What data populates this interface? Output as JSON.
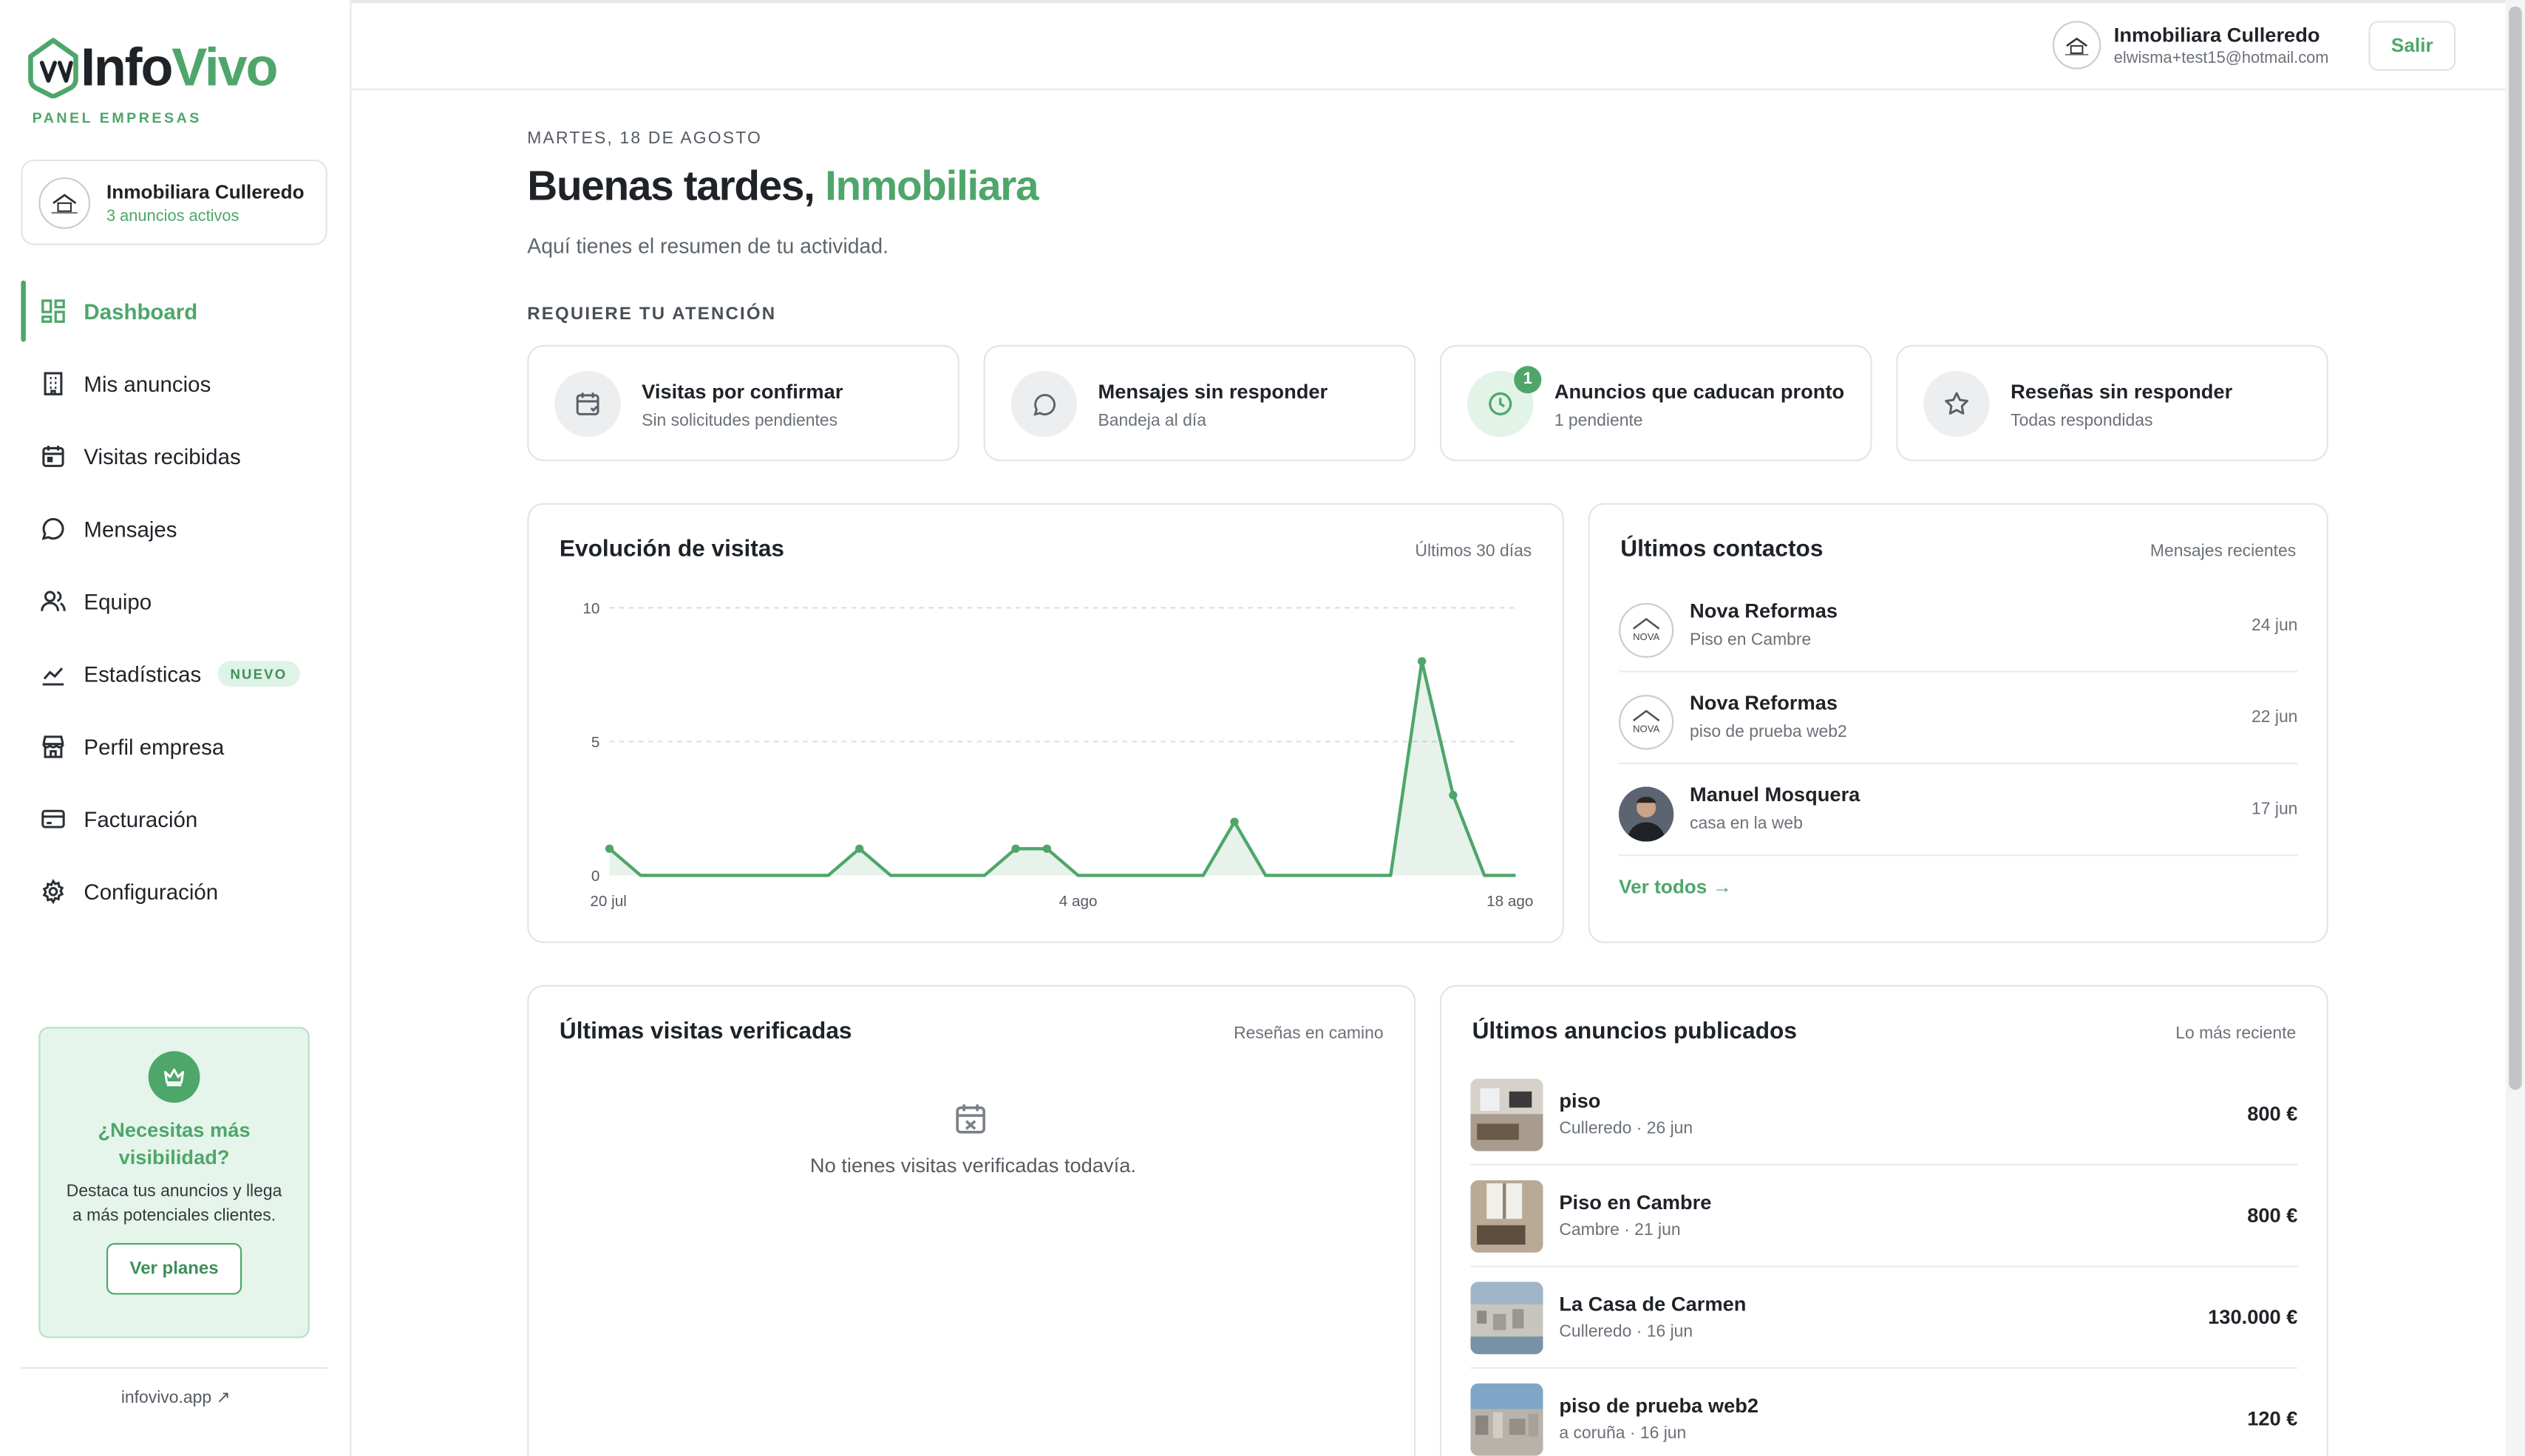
{
  "brand": {
    "name_a": "Info",
    "name_b": "Vivo",
    "subtitle": "PANEL EMPRESAS"
  },
  "sidebar": {
    "company": {
      "name": "Inmobiliara Culleredo",
      "status": "3 anuncios activos"
    },
    "items": [
      {
        "label": "Dashboard",
        "icon": "dashboard-icon",
        "active": true
      },
      {
        "label": "Mis anuncios",
        "icon": "building-icon"
      },
      {
        "label": "Visitas recibidas",
        "icon": "calendar-icon"
      },
      {
        "label": "Mensajes",
        "icon": "chat-icon"
      },
      {
        "label": "Equipo",
        "icon": "users-icon"
      },
      {
        "label": "Estadísticas",
        "icon": "chart-icon",
        "badge": "NUEVO"
      },
      {
        "label": "Perfil empresa",
        "icon": "store-icon"
      },
      {
        "label": "Facturación",
        "icon": "card-icon"
      },
      {
        "label": "Configuración",
        "icon": "gear-icon"
      }
    ],
    "promo": {
      "title": "¿Necesitas más visibilidad?",
      "text": "Destaca tus anuncios y llega a más potenciales clientes.",
      "button": "Ver planes"
    },
    "footer_link": "infovivo.app ↗"
  },
  "header": {
    "user_name": "Inmobiliara Culleredo",
    "user_email": "elwisma+test15@hotmail.com",
    "logout": "Salir"
  },
  "main": {
    "date": "MARTES, 18 DE AGOSTO",
    "greeting": "Buenas tardes, ",
    "greeting_name": "Inmobiliara",
    "subtitle": "Aquí tienes el resumen de tu actividad.",
    "attention_title": "REQUIERE TU ATENCIÓN",
    "attention": [
      {
        "title": "Visitas por confirmar",
        "sub": "Sin solicitudes pendientes",
        "icon": "calendar-icon"
      },
      {
        "title": "Mensajes sin responder",
        "sub": "Bandeja al día",
        "icon": "chat-icon"
      },
      {
        "title": "Anuncios que caducan pronto",
        "sub": "1 pendiente",
        "icon": "clock-icon",
        "count": "1"
      },
      {
        "title": "Reseñas sin responder",
        "sub": "Todas respondidas",
        "icon": "star-icon"
      }
    ],
    "chart_card": {
      "title": "Evolución de visitas",
      "range": "Últimos 30 días"
    },
    "contacts": {
      "title": "Últimos contactos",
      "caption": "Mensajes recientes",
      "items": [
        {
          "name": "Nova Reformas",
          "sub": "Piso en Cambre",
          "date": "24 jun"
        },
        {
          "name": "Nova Reformas",
          "sub": "piso de prueba web2",
          "date": "22 jun"
        },
        {
          "name": "Manuel Mosquera",
          "sub": "casa en la web",
          "date": "17 jun"
        }
      ],
      "link": "Ver todos →"
    },
    "verified": {
      "title": "Últimas visitas verificadas",
      "caption": "Reseñas en camino",
      "empty": "No tienes visitas verificadas todavía."
    },
    "listings": {
      "title": "Últimos anuncios publicados",
      "caption": "Lo más reciente",
      "items": [
        {
          "name": "piso",
          "sub": "Culleredo · 26 jun",
          "price": "800 €"
        },
        {
          "name": "Piso en Cambre",
          "sub": "Cambre · 21 jun",
          "price": "800 €"
        },
        {
          "name": "La Casa de Carmen",
          "sub": "Culleredo · 16 jun",
          "price": "130.000 €"
        },
        {
          "name": "piso de prueba web2",
          "sub": "a coruña · 16 jun",
          "price": "120 €"
        }
      ]
    }
  },
  "chart_data": {
    "type": "area",
    "x": [
      "20 jul",
      "21 jul",
      "22 jul",
      "23 jul",
      "24 jul",
      "25 jul",
      "26 jul",
      "27 jul",
      "28 jul",
      "29 jul",
      "30 jul",
      "31 jul",
      "1 ago",
      "2 ago",
      "3 ago",
      "4 ago",
      "5 ago",
      "6 ago",
      "7 ago",
      "8 ago",
      "9 ago",
      "10 ago",
      "11 ago",
      "12 ago",
      "13 ago",
      "14 ago",
      "15 ago",
      "16 ago",
      "17 ago",
      "18 ago"
    ],
    "values": [
      1,
      0,
      0,
      0,
      0,
      0,
      0,
      0,
      1,
      0,
      0,
      0,
      0,
      1,
      1,
      0,
      0,
      0,
      0,
      0,
      2,
      0,
      0,
      0,
      0,
      0,
      8,
      3,
      0,
      0
    ],
    "xticks": [
      "20 jul",
      "4 ago",
      "18 ago"
    ],
    "yticks": [
      0,
      5,
      10
    ],
    "ylim": [
      0,
      10
    ],
    "grid": true,
    "color": "#4ea66b"
  }
}
